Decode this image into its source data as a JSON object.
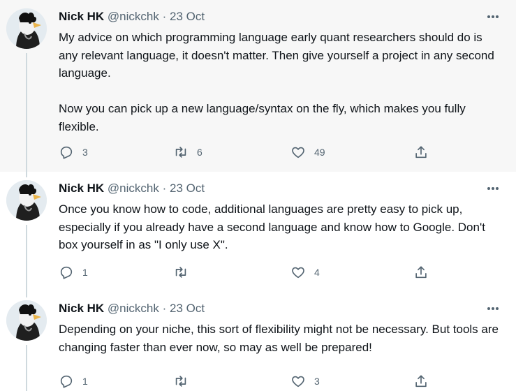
{
  "tweets": [
    {
      "name": "Nick HK",
      "handle": "@nickchk",
      "separator": "·",
      "date": "23 Oct",
      "text": "My advice on which programming language early quant researchers should do is any relevant language, it doesn't matter. Then give yourself a project in any second language.\n\nNow you can pick up a new language/syntax on the fly, which makes you fully flexible.",
      "replies": "3",
      "retweets": "6",
      "likes": "49"
    },
    {
      "name": "Nick HK",
      "handle": "@nickchk",
      "separator": "·",
      "date": "23 Oct",
      "text": "Once you know how to code, additional languages are pretty easy to pick up, especially if you already have a second language and know how to Google. Don't box yourself in as \"I only use X\".",
      "replies": "1",
      "retweets": "",
      "likes": "4"
    },
    {
      "name": "Nick HK",
      "handle": "@nickchk",
      "separator": "·",
      "date": "23 Oct",
      "text": "Depending on your niche, this sort of flexibility might not be necessary. But tools are changing faster than ever now, so may as well be prepared!",
      "replies": "1",
      "retweets": "",
      "likes": "3"
    }
  ],
  "icons": {
    "reply": "reply-icon",
    "retweet": "retweet-icon",
    "like": "like-icon",
    "share": "share-icon",
    "more": "more-icon"
  },
  "colors": {
    "text": "#0f1419",
    "muted": "#536471",
    "highlight_bg": "#f7f7f7",
    "thread_line": "#cfd9de"
  }
}
